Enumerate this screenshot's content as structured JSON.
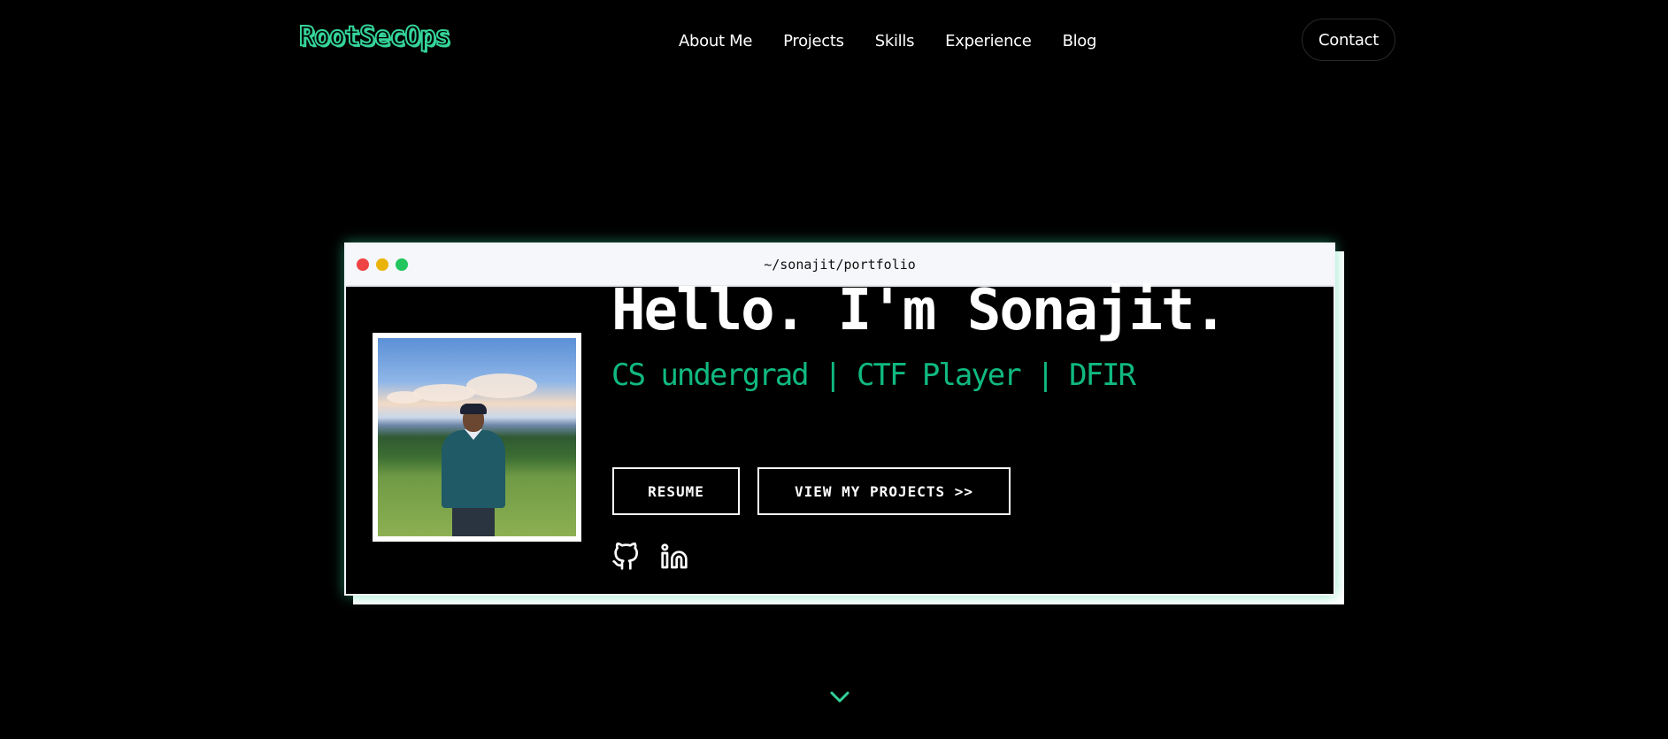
{
  "brand": {
    "logo_text": "RootSecOps",
    "accent": "#34d399"
  },
  "nav": {
    "items": [
      "About Me",
      "Projects",
      "Skills",
      "Experience",
      "Blog"
    ],
    "contact_label": "Contact"
  },
  "terminal": {
    "path": "~/sonajit/portfolio",
    "dot_colors": [
      "#ef4444",
      "#eab308",
      "#22c55e"
    ]
  },
  "hero": {
    "greeting": "Hello. I'm Sonajit.",
    "tagline": "CS undergrad | CTF Player | DFIR",
    "tagline_color": "#10b981",
    "resume_label": "RESUME",
    "projects_label": "VIEW MY PROJECTS >>"
  },
  "social": {
    "icons": [
      "github-icon",
      "linkedin-icon"
    ]
  },
  "scroll": {
    "icon": "chevron-down-icon"
  }
}
